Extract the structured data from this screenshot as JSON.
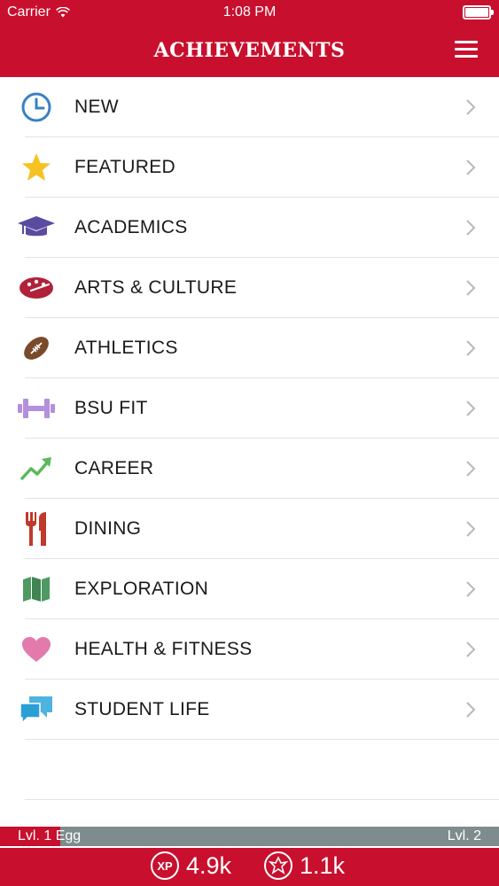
{
  "status_bar": {
    "carrier": "Carrier",
    "time": "1:08 PM"
  },
  "header": {
    "title": "ACHIEVEMENTS"
  },
  "categories": [
    {
      "label": "NEW",
      "icon": "clock-icon"
    },
    {
      "label": "FEATURED",
      "icon": "star-icon"
    },
    {
      "label": "ACADEMICS",
      "icon": "graduation-cap-icon"
    },
    {
      "label": "ARTS & CULTURE",
      "icon": "palette-icon"
    },
    {
      "label": "ATHLETICS",
      "icon": "football-icon"
    },
    {
      "label": "BSU FIT",
      "icon": "dumbbell-icon"
    },
    {
      "label": "CAREER",
      "icon": "trending-up-icon"
    },
    {
      "label": "DINING",
      "icon": "fork-knife-icon"
    },
    {
      "label": "EXPLORATION",
      "icon": "map-icon"
    },
    {
      "label": "HEALTH & FITNESS",
      "icon": "heart-icon"
    },
    {
      "label": "STUDENT LIFE",
      "icon": "chat-bubbles-icon"
    }
  ],
  "level": {
    "current": "Lvl. 1 Egg",
    "next": "Lvl. 2",
    "progress_fraction": 0.12
  },
  "stats": {
    "xp": "4.9k",
    "points": "1.1k",
    "xp_badge": "XP"
  },
  "colors": {
    "brand_red": "#c8102e",
    "level_track": "#7f8c8d"
  }
}
